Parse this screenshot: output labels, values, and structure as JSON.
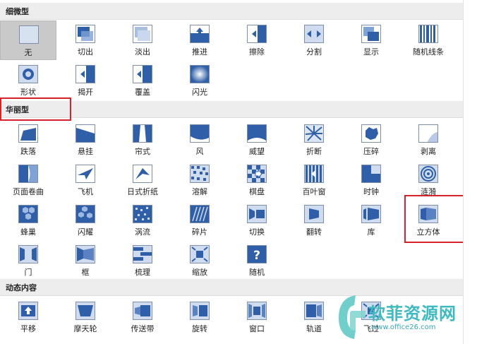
{
  "sections": [
    {
      "title": "细微型"
    },
    {
      "title": "华丽型"
    },
    {
      "title": "动态内容"
    }
  ],
  "subtle": [
    {
      "label": "无",
      "icon": "none-icon"
    },
    {
      "label": "切出",
      "icon": "cut-icon"
    },
    {
      "label": "淡出",
      "icon": "fade-icon"
    },
    {
      "label": "推进",
      "icon": "push-icon"
    },
    {
      "label": "擦除",
      "icon": "wipe-icon"
    },
    {
      "label": "分割",
      "icon": "split-icon"
    },
    {
      "label": "显示",
      "icon": "reveal-icon"
    },
    {
      "label": "随机线条",
      "icon": "random-bars-icon"
    },
    {
      "label": "形状",
      "icon": "shape-icon"
    },
    {
      "label": "揭开",
      "icon": "uncover-icon"
    },
    {
      "label": "覆盖",
      "icon": "cover-icon"
    },
    {
      "label": "闪光",
      "icon": "flash-icon"
    }
  ],
  "exciting": [
    {
      "label": "跌落",
      "icon": "fall-over-icon"
    },
    {
      "label": "悬挂",
      "icon": "drape-icon"
    },
    {
      "label": "帘式",
      "icon": "curtains-icon"
    },
    {
      "label": "风",
      "icon": "wind-icon"
    },
    {
      "label": "威望",
      "icon": "prestige-icon"
    },
    {
      "label": "折断",
      "icon": "fracture-icon"
    },
    {
      "label": "压碎",
      "icon": "crush-icon"
    },
    {
      "label": "剥离",
      "icon": "peel-off-icon"
    },
    {
      "label": "页面卷曲",
      "icon": "page-curl-icon"
    },
    {
      "label": "飞机",
      "icon": "airplane-icon"
    },
    {
      "label": "日式折纸",
      "icon": "origami-icon"
    },
    {
      "label": "溶解",
      "icon": "dissolve-icon"
    },
    {
      "label": "棋盘",
      "icon": "checkerboard-icon"
    },
    {
      "label": "百叶窗",
      "icon": "blinds-icon"
    },
    {
      "label": "时钟",
      "icon": "clock-icon"
    },
    {
      "label": "涟漪",
      "icon": "ripple-icon"
    },
    {
      "label": "蜂巢",
      "icon": "honeycomb-icon"
    },
    {
      "label": "闪耀",
      "icon": "glitter-icon"
    },
    {
      "label": "涡流",
      "icon": "vortex-icon"
    },
    {
      "label": "碎片",
      "icon": "shred-icon"
    },
    {
      "label": "切换",
      "icon": "switch-icon"
    },
    {
      "label": "翻转",
      "icon": "flip-icon"
    },
    {
      "label": "库",
      "icon": "gallery-icon"
    },
    {
      "label": "立方体",
      "icon": "cube-icon"
    },
    {
      "label": "门",
      "icon": "doors-icon"
    },
    {
      "label": "框",
      "icon": "box-icon"
    },
    {
      "label": "梳理",
      "icon": "comb-icon"
    },
    {
      "label": "缩放",
      "icon": "zoom-icon"
    },
    {
      "label": "随机",
      "icon": "random-icon"
    }
  ],
  "dynamic": [
    {
      "label": "平移",
      "icon": "pan-icon"
    },
    {
      "label": "摩天轮",
      "icon": "ferris-wheel-icon"
    },
    {
      "label": "传送带",
      "icon": "conveyor-icon"
    },
    {
      "label": "旋转",
      "icon": "rotate-icon"
    },
    {
      "label": "窗口",
      "icon": "window-icon"
    },
    {
      "label": "轨道",
      "icon": "orbit-icon"
    },
    {
      "label": "飞过",
      "icon": "fly-through-icon"
    }
  ],
  "watermark": {
    "title": "软菲资源网",
    "url": "www.office26.com"
  },
  "colors": {
    "accent": "#2f5fa8",
    "highlight": "#d9212a",
    "selected_bg": "#c9c9c9",
    "header_bg": "#ededed"
  }
}
